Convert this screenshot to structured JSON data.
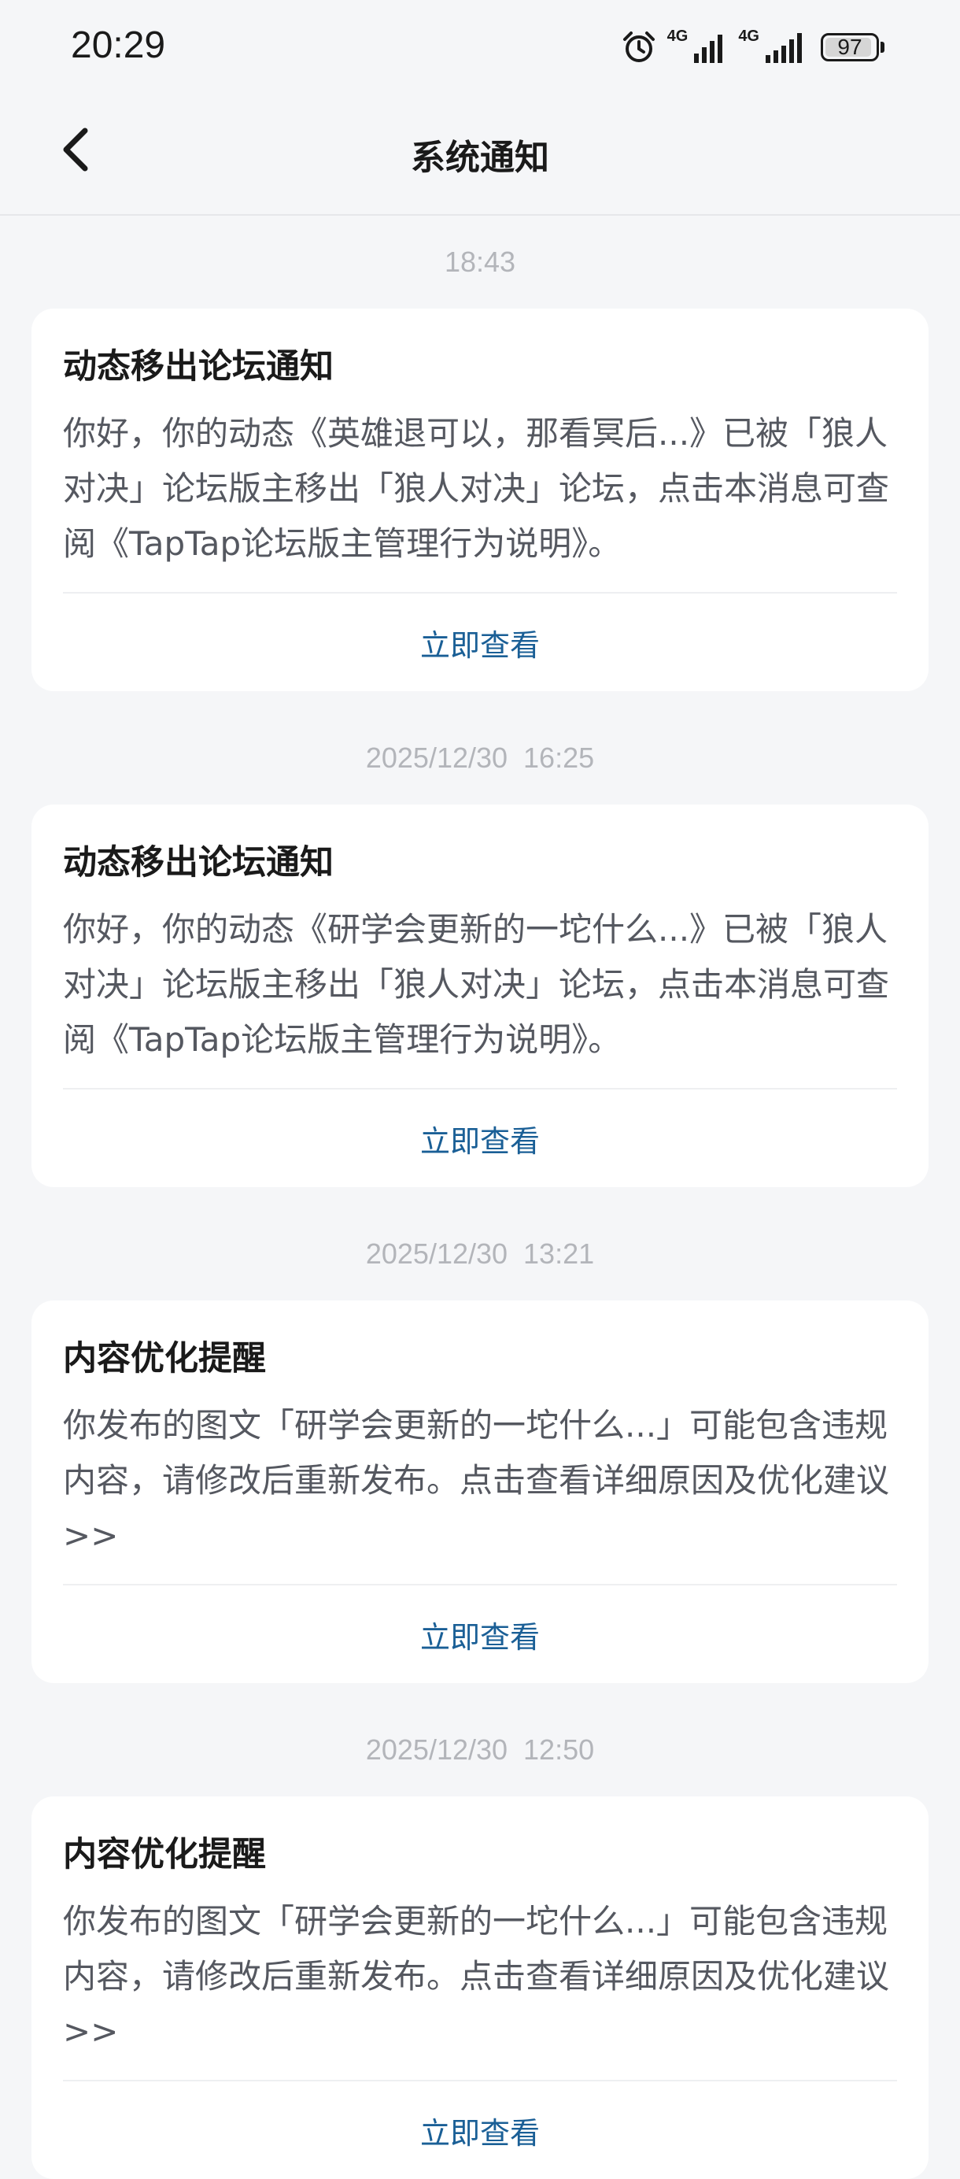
{
  "status_bar": {
    "time": "20:29",
    "network_1": "4G",
    "network_2": "4G",
    "battery": "97"
  },
  "nav": {
    "title": "系统通知"
  },
  "notifications": [
    {
      "time": "18:43",
      "title": "动态移出论坛通知",
      "body": "你好，你的动态《英雄退可以，那看冥后...》已被「狼人对决」论坛版主移出「狼人对决」论坛，点击本消息可查阅《TapTap论坛版主管理行为说明》。",
      "action": "立即查看"
    },
    {
      "time": "2025/12/30  16:25",
      "title": "动态移出论坛通知",
      "body": "你好，你的动态《研学会更新的一坨什么...》已被「狼人对决」论坛版主移出「狼人对决」论坛，点击本消息可查阅《TapTap论坛版主管理行为说明》。",
      "action": "立即查看"
    },
    {
      "time": "2025/12/30  13:21",
      "title": "内容优化提醒",
      "body": "你发布的图文「研学会更新的一坨什么...」可能包含违规内容，请修改后重新发布。点击查看详细原因及优化建议>>",
      "action": "立即查看"
    },
    {
      "time": "2025/12/30  12:50",
      "title": "内容优化提醒",
      "body": "你发布的图文「研学会更新的一坨什么...」可能包含违规内容，请修改后重新发布。点击查看详细原因及优化建议>>",
      "action": "立即查看"
    }
  ]
}
